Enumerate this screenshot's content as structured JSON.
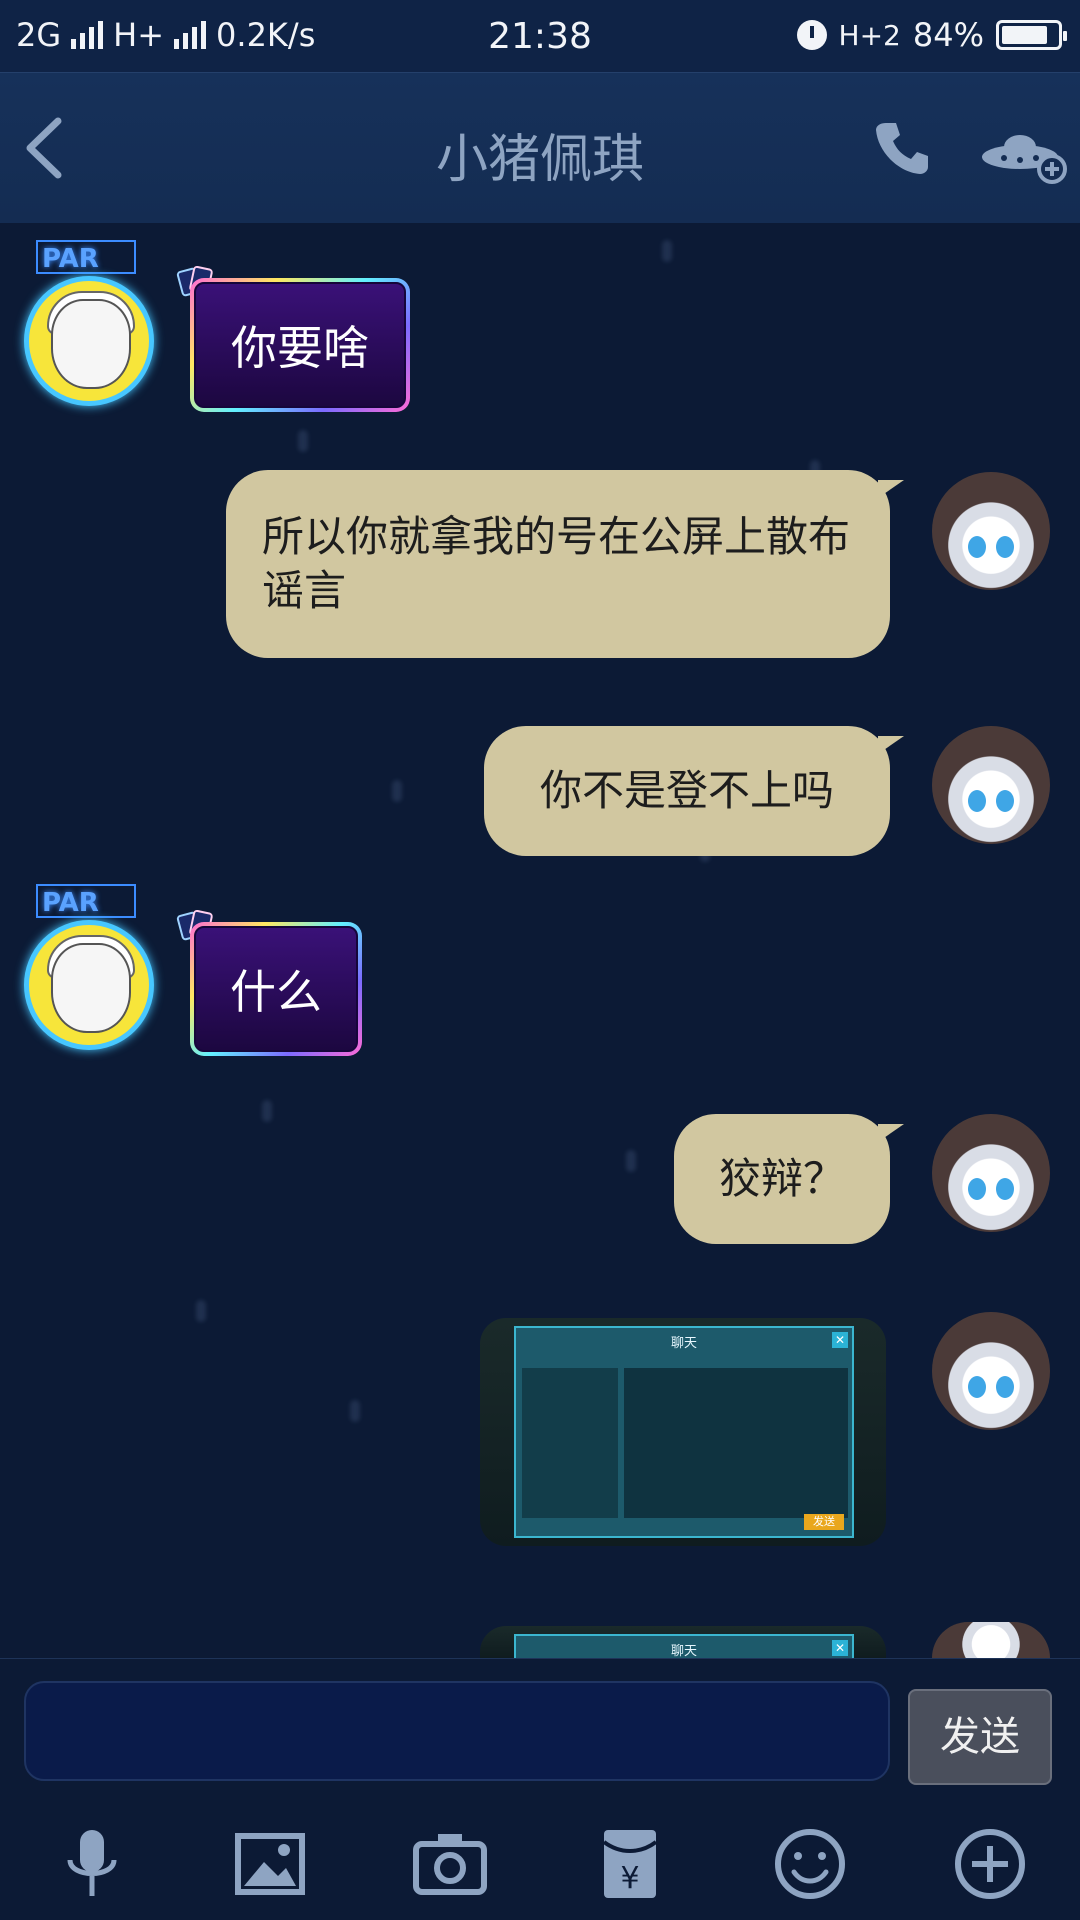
{
  "status_bar": {
    "network1": "2G",
    "network2": "H+",
    "speed": "0.2K/s",
    "time": "21:38",
    "network3": "H+2",
    "battery": "84%",
    "battery_level": 0.84
  },
  "header": {
    "title": "小猪佩琪",
    "back_icon": "chevron-left-icon",
    "call_icon": "phone-icon",
    "more_icon": "ufo-add-icon"
  },
  "messages": [
    {
      "side": "left",
      "text": "你要啥",
      "badge": "PAR"
    },
    {
      "side": "right",
      "text": "所以你就拿我的号在公屏上散布谣言"
    },
    {
      "side": "right",
      "text": "你不是登不上吗"
    },
    {
      "side": "left",
      "text": "什么",
      "badge": "PAR"
    },
    {
      "side": "right",
      "text": "狡辩？"
    },
    {
      "side": "right",
      "type": "image",
      "image_title": "聊天",
      "send_label": "发送"
    },
    {
      "side": "right",
      "type": "image",
      "image_title": "聊天"
    }
  ],
  "input": {
    "placeholder": "",
    "send_label": "发送"
  },
  "toolbar": [
    {
      "icon": "microphone-icon"
    },
    {
      "icon": "image-icon"
    },
    {
      "icon": "camera-icon"
    },
    {
      "icon": "red-packet-icon",
      "symbol": "¥"
    },
    {
      "icon": "emoji-icon"
    },
    {
      "icon": "plus-icon"
    }
  ]
}
